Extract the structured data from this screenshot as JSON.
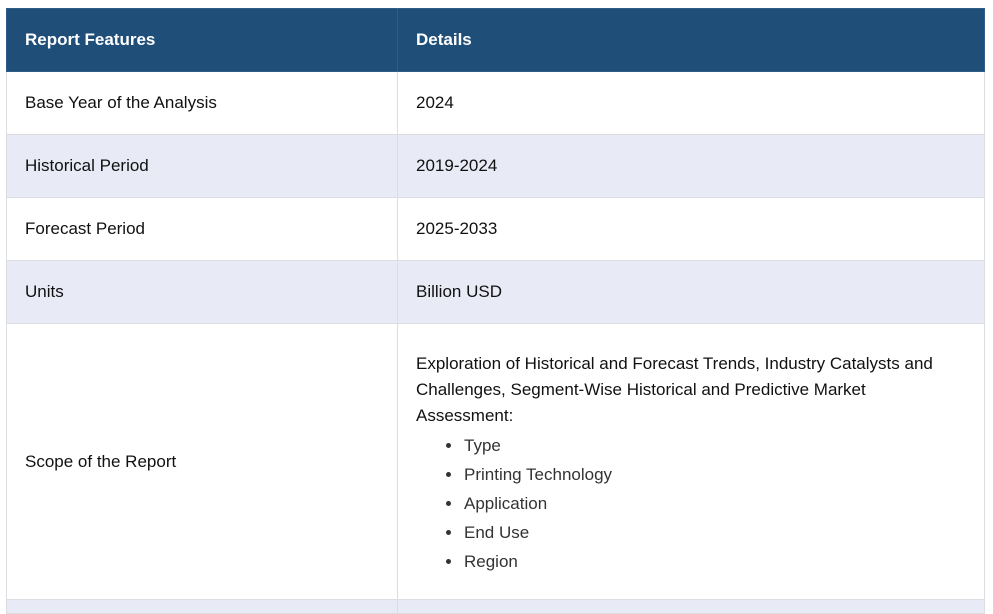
{
  "table": {
    "headers": [
      "Report Features",
      "Details"
    ],
    "rows": [
      {
        "feature": "Base Year of the Analysis",
        "detail": "2024"
      },
      {
        "feature": "Historical Period",
        "detail": "2019-2024"
      },
      {
        "feature": "Forecast Period",
        "detail": "2025-2033"
      },
      {
        "feature": "Units",
        "detail": "Billion USD"
      }
    ],
    "scope": {
      "feature": "Scope of the Report",
      "intro": "Exploration of Historical and Forecast Trends, Industry Catalysts and Challenges, Segment-Wise Historical and Predictive Market Assessment:",
      "bullets": [
        "Type",
        "Printing Technology",
        "Application",
        "End Use",
        "Region"
      ]
    }
  },
  "colors": {
    "header_bg": "#1f4e79",
    "alt_row_bg": "#e8eaf5",
    "border": "#dcdde3"
  }
}
